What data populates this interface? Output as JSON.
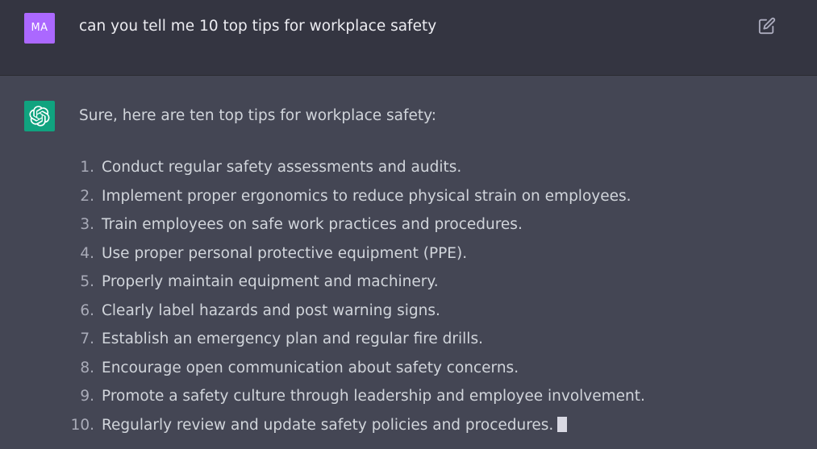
{
  "user_message": {
    "avatar_initials": "MA",
    "text": "can you tell me 10 top tips for workplace safety",
    "edit_icon": "edit-icon"
  },
  "assistant_message": {
    "avatar_icon": "openai-logo-icon",
    "intro": "Sure, here are ten top tips for workplace safety:",
    "tips": [
      {
        "number": "1.",
        "text": "Conduct regular safety assessments and audits."
      },
      {
        "number": "2.",
        "text": "Implement proper ergonomics to reduce physical strain on employees."
      },
      {
        "number": "3.",
        "text": "Train employees on safe work practices and procedures."
      },
      {
        "number": "4.",
        "text": "Use proper personal protective equipment (PPE)."
      },
      {
        "number": "5.",
        "text": "Properly maintain equipment and machinery."
      },
      {
        "number": "6.",
        "text": "Clearly label hazards and post warning signs."
      },
      {
        "number": "7.",
        "text": "Establish an emergency plan and regular fire drills."
      },
      {
        "number": "8.",
        "text": "Encourage open communication about safety concerns."
      },
      {
        "number": "9.",
        "text": "Promote a safety culture through leadership and employee involvement."
      },
      {
        "number": "10.",
        "text": "Regularly review and update safety policies and procedures."
      }
    ]
  },
  "colors": {
    "user_row_bg": "#343541",
    "assistant_row_bg": "#444654",
    "user_avatar": "#ab68ff",
    "bot_avatar": "#10a37f",
    "text": "#d1d5db"
  }
}
